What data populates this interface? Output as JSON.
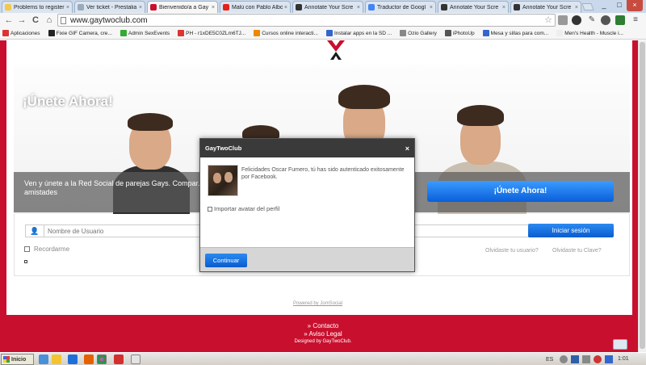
{
  "browser": {
    "tabs": [
      {
        "label": "Problems to register",
        "icon_color": "#f2c94c"
      },
      {
        "label": "Ver ticket - Prestalia",
        "icon_color": "#9ab"
      },
      {
        "label": "Bienvenido/a a Gay",
        "icon_color": "#c8102e",
        "active": true
      },
      {
        "label": "Malú con Pablo Albo",
        "icon_color": "#e62117"
      },
      {
        "label": "Annotate Your Scre",
        "icon_color": "#333"
      },
      {
        "label": "Traductor de Googl",
        "icon_color": "#4285f4"
      },
      {
        "label": "Annotate Your Scre",
        "icon_color": "#333"
      },
      {
        "label": "Annotate Your Scre",
        "icon_color": "#333"
      }
    ],
    "tab_close": "×",
    "window_controls": {
      "minimize": "_",
      "maximize": "□",
      "close": "×"
    },
    "nav": {
      "back": "←",
      "forward": "→",
      "reload": "C",
      "home": "⌂"
    },
    "url": "www.gaytwoclub.com",
    "star": "☆",
    "bookmarks": [
      {
        "label": "Aplicaciones",
        "color": "#d33"
      },
      {
        "label": "Fixie GIF Camera, cre...",
        "color": "#222"
      },
      {
        "label": "Admin SexEvents",
        "color": "#3a3"
      },
      {
        "label": "PH - r1xDE5C0ZLm6TJ...",
        "color": "#d33"
      },
      {
        "label": "Cursos online interacti...",
        "color": "#e80"
      },
      {
        "label": "Instalar apps en la SD ...",
        "color": "#36c"
      },
      {
        "label": "Ozio Gallery",
        "color": "#888"
      },
      {
        "label": "iPhotoUp",
        "color": "#555"
      },
      {
        "label": "Mesa y sillas para com...",
        "color": "#36c"
      },
      {
        "label": "Men's Health - Muscle i...",
        "color": "#eee"
      }
    ]
  },
  "site": {
    "hero_title": "¡Únete Ahora!",
    "band_text": "Ven y únete a la Red Social de parejas Gays. Compar... otras amistades",
    "cta_label": "¡Únete Ahora!",
    "username_placeholder": "Nombre de Usuario",
    "user_icon": "👤",
    "login_label": "Iniciar sesión",
    "remember_label": "Recordarme",
    "forgot_user": "Olvidaste tu usuario?",
    "forgot_pass": "Olvidaste tu Clave?",
    "powered": "Powered by JomSocial",
    "footer_contact": "» Contacto",
    "footer_legal": "» Aviso Legal",
    "footer_designed": "Designed by GayTwoClub.",
    "brand_color": "#c8102e"
  },
  "modal": {
    "title": "GayTwoClub",
    "close": "×",
    "message": "Felicidades Oscar Fumero, tú has sido autenticado exitosamente por Facebook.",
    "import_label": "Importar avatar del perfil",
    "continue_label": "Continuar"
  },
  "taskbar": {
    "start_label": "Inicio",
    "language": "ES",
    "clock": "1:01"
  }
}
